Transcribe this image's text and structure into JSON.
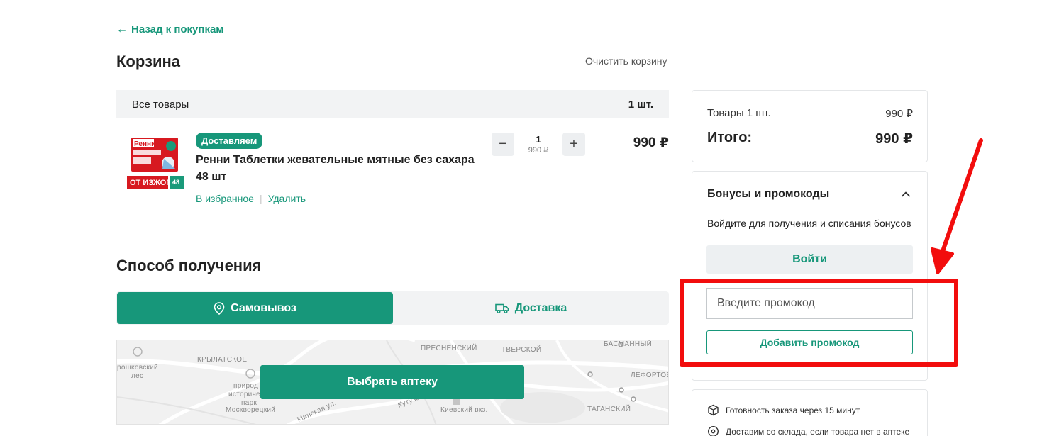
{
  "nav": {
    "back_label": "Назад к покупкам"
  },
  "cart": {
    "title": "Корзина",
    "clear_label": "Очистить корзину",
    "all_items_label": "Все товары",
    "all_items_count": "1 шт."
  },
  "product": {
    "badge": "Доставляем",
    "name": "Ренни Таблетки жевательные мятные без сахара 48 шт",
    "favorite_label": "В избранное",
    "separator": "|",
    "remove_label": "Удалить",
    "quantity": "1",
    "unit_price": "990 ₽",
    "line_price": "990 ₽",
    "image": {
      "brand_text": "Ренни",
      "banner_text": "ОТ ИЗЖОГИ",
      "count_text": "48",
      "colors": {
        "box": "#d71920",
        "accent": "#1a9a7a"
      }
    }
  },
  "delivery": {
    "title": "Способ получения",
    "tabs": [
      {
        "label": "Самовывоз",
        "icon": "location-pin-icon",
        "active": true
      },
      {
        "label": "Доставка",
        "icon": "truck-icon",
        "active": false
      }
    ],
    "choose_pharmacy_label": "Выбрать аптеку",
    "map_labels": {
      "l1": "рошковский",
      "l2": "лес",
      "l3": "КРЫЛАТСКОЕ",
      "l4": "ПРЕСНЕНСКИЙ",
      "l5": "ТВЕРСКОЙ",
      "l6": "БАСМАННЫЙ",
      "l7": "ЛЕФОРТОВО",
      "l8": "природ",
      "l9": "историче",
      "l10": "парк",
      "l11": "Москворецкий",
      "l12": "Кутузов",
      "l13": "Киевский вкз.",
      "l14": "ТАГАНСКИЙ",
      "l15": "Минская ул."
    }
  },
  "summary": {
    "items_label": "Товары 1 шт.",
    "items_value": "990 ₽",
    "total_label": "Итого:",
    "total_value": "990 ₽"
  },
  "bonuses": {
    "title": "Бонусы и промокоды",
    "login_prompt": "Войдите для получения и списания бонусов",
    "login_button": "Войти",
    "promo_placeholder": "Введите промокод",
    "add_promo_button": "Добавить промокод"
  },
  "info": {
    "ready_text": "Готовность заказа через 15 минут",
    "warehouse_text": "Доставим со склада, если товара нет в аптеке"
  },
  "colors": {
    "accent": "#17977a",
    "highlight": "#f20d0d"
  }
}
